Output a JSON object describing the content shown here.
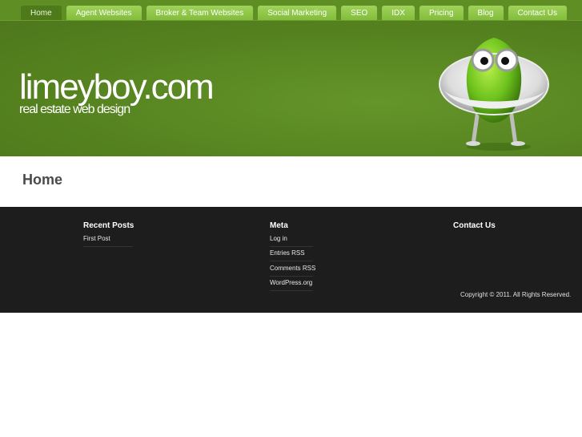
{
  "nav": {
    "items": [
      {
        "label": "Home",
        "active": true
      },
      {
        "label": "Agent Websites",
        "active": false
      },
      {
        "label": "Broker & Team Websites",
        "active": false
      },
      {
        "label": "Social Marketing",
        "active": false
      },
      {
        "label": "SEO",
        "active": false
      },
      {
        "label": "IDX",
        "active": false
      },
      {
        "label": "Pricing",
        "active": false
      },
      {
        "label": "Blog",
        "active": false
      },
      {
        "label": "Contact Us",
        "active": false
      }
    ]
  },
  "header": {
    "logo_title": "limeyboy.com",
    "logo_tagline": "real estate web design"
  },
  "main": {
    "page_title": "Home"
  },
  "footer": {
    "recent_posts": {
      "heading": "Recent Posts",
      "items": [
        "First Post"
      ]
    },
    "meta": {
      "heading": "Meta",
      "items": [
        "Log in",
        "Entries RSS",
        "Comments RSS",
        "WordPress.org"
      ]
    },
    "contact": {
      "heading": "Contact Us"
    },
    "copyright": "Copyright © 2011. All Rights Reserved."
  },
  "colors": {
    "header_green": "#5b8a22",
    "nav_tab": "#8fc74a",
    "footer_bg": "#1d1d1d"
  }
}
